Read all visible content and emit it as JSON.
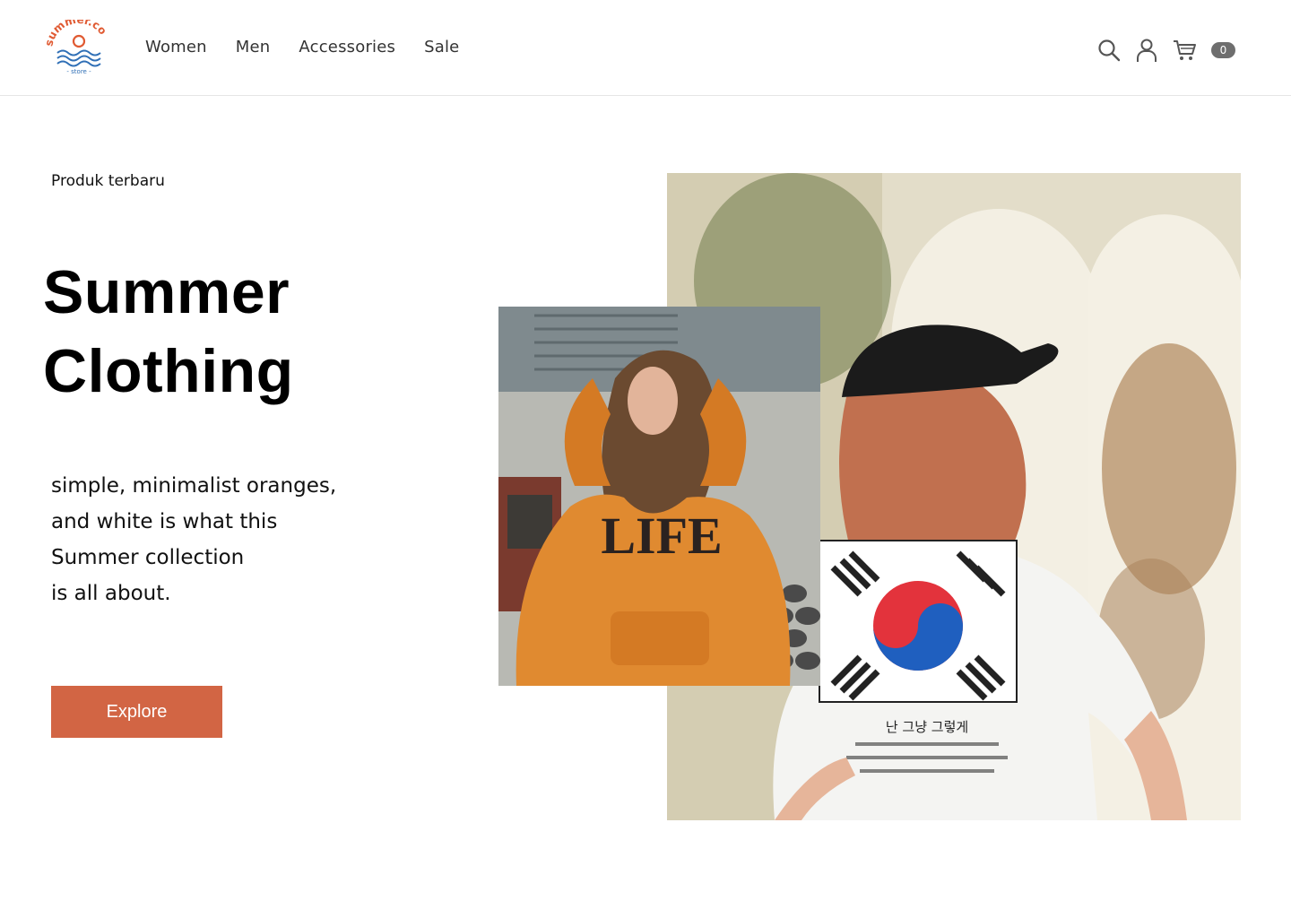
{
  "brand": {
    "logo_text": "summer.co",
    "logo_sub": "store",
    "logo_color": "#e05a32",
    "logo_wave_color": "#2f6fb6"
  },
  "nav": {
    "items": [
      {
        "label": "Women"
      },
      {
        "label": "Men"
      },
      {
        "label": "Accessories"
      },
      {
        "label": "Sale"
      }
    ]
  },
  "header_icons": {
    "search": "search-icon",
    "account": "user-icon",
    "cart": "cart-icon",
    "cart_count": "0"
  },
  "hero": {
    "eyebrow": "Produk terbaru",
    "title_line1": "Summer",
    "title_line2": "Clothing",
    "desc_lines": [
      "simple, minimalist oranges,",
      "and white is what this",
      "Summer collection",
      "is all about."
    ],
    "cta_label": "Explore",
    "accent_color": "#d26544"
  },
  "images": {
    "small_shirt_text": "LIFE",
    "large_shirt_text": "난 그냥 그렇게"
  }
}
